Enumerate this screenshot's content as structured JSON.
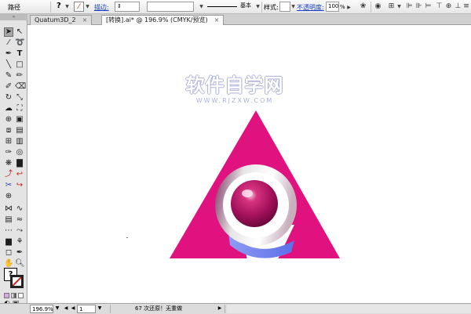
{
  "control_bar": {
    "selection_label": "路径",
    "fill_glyph": "?",
    "stroke_link": "描边:",
    "style_value": "基本",
    "style_label": "样式:",
    "opacity_link": "不透明度:",
    "opacity_value": "100",
    "opacity_unit": "%"
  },
  "tabs": [
    {
      "label": "Quatum3D_2",
      "active": false
    },
    {
      "label": "[转换].ai* @ 196.9% (CMYK/预览)",
      "active": true
    }
  ],
  "tools_panel": {
    "grip_label": "«",
    "fill_glyph": "?"
  },
  "canvas": {
    "watermark_title": "软件自学网",
    "watermark_url": "WWW.RJZXW.COM",
    "artwork_colors": {
      "triangle": "#e0127f",
      "ring": "#c8c8c8",
      "sphere": "#a3105c",
      "crescent": "#6b7ff0"
    }
  },
  "status_bar": {
    "zoom": "196.9%",
    "page": "1",
    "info": "67 次还原！无重做"
  },
  "icons": [
    "selection-arrow-icon",
    "direct-select-icon",
    "magic-wand-icon",
    "lasso-icon",
    "pen-icon",
    "type-icon",
    "line-icon",
    "rectangle-icon",
    "brush-icon",
    "pencil-icon",
    "eraser-icon",
    "rotate-icon",
    "scale-icon",
    "warp-icon",
    "free-transform-icon",
    "symbol-sprayer-icon",
    "column-graph-icon",
    "mesh-icon",
    "gradient-icon",
    "eyedropper-icon",
    "blend-icon",
    "live-paint-icon",
    "slice-icon",
    "scissors-icon",
    "hand-icon",
    "zoom-icon"
  ]
}
